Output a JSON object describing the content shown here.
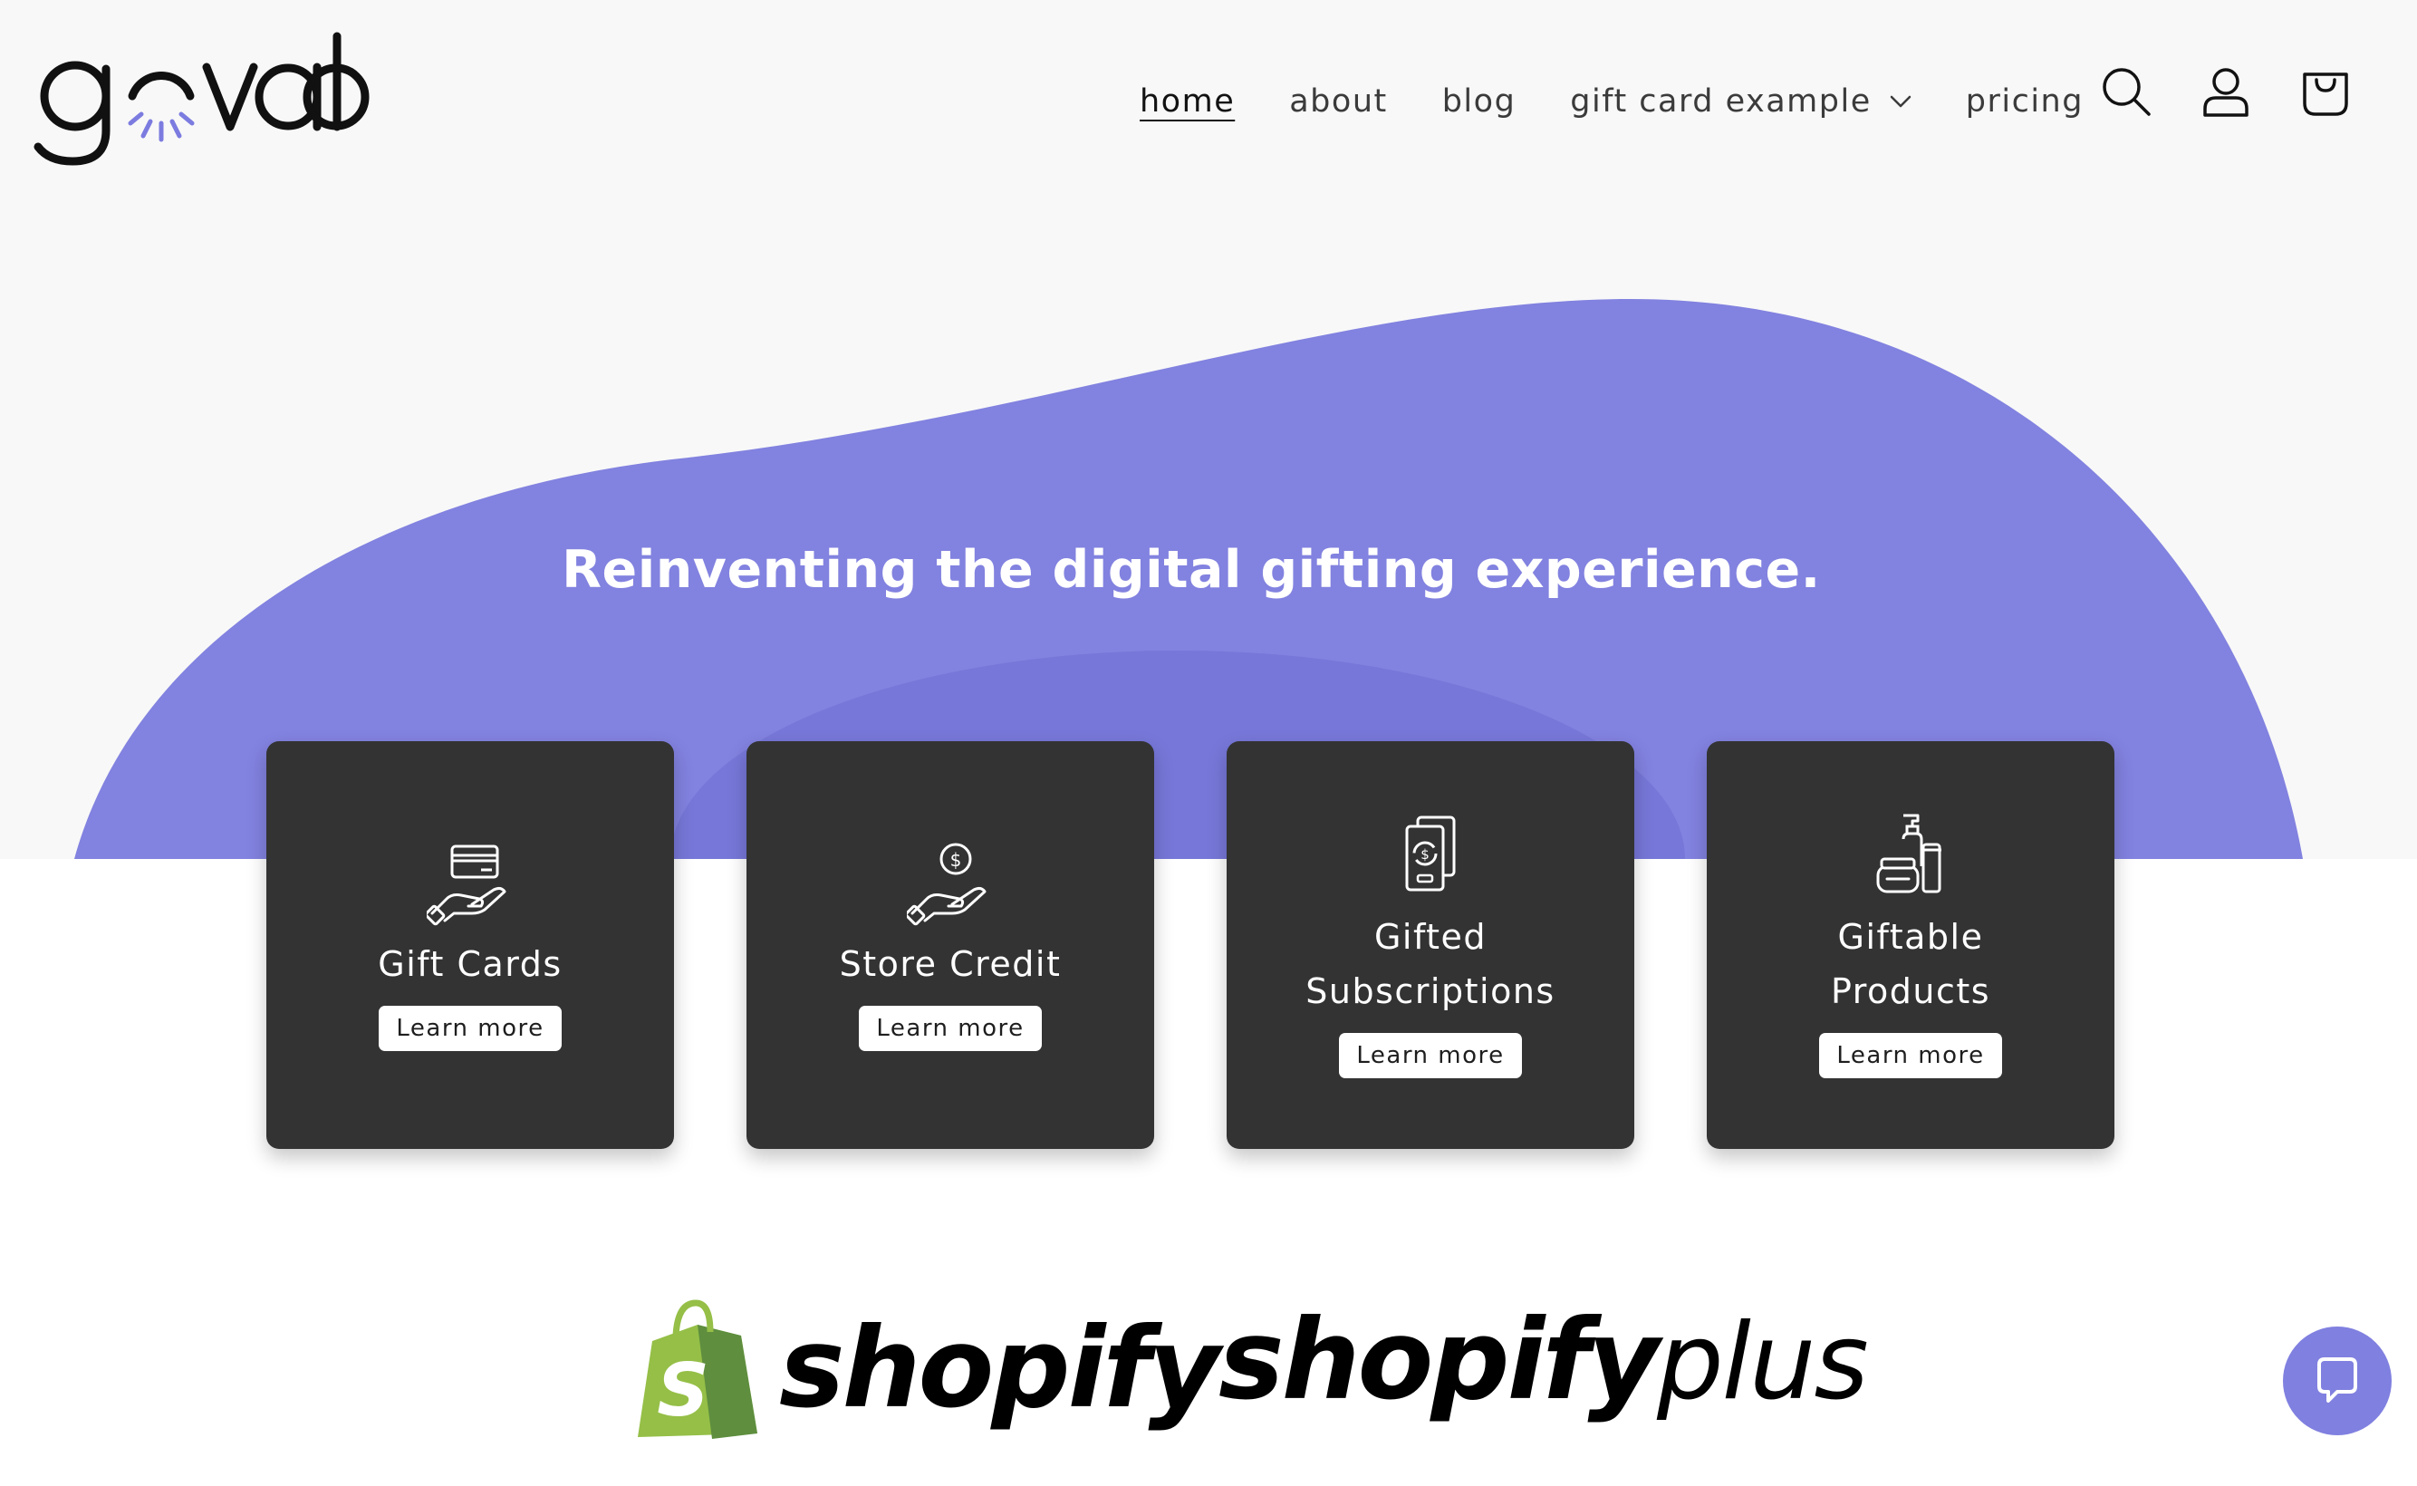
{
  "brand": {
    "logo_text": "govalo",
    "accent_color": "#8282e0"
  },
  "nav": {
    "items": [
      {
        "label": "home",
        "active": true
      },
      {
        "label": "about",
        "active": false
      },
      {
        "label": "blog",
        "active": false
      },
      {
        "label": "gift card example",
        "active": false,
        "has_dropdown": true
      },
      {
        "label": "pricing",
        "active": false
      }
    ]
  },
  "header_icons": [
    "search-icon",
    "account-icon",
    "cart-icon"
  ],
  "hero": {
    "title": "Reinventing the digital gifting experience."
  },
  "cards": [
    {
      "title": "Gift Cards",
      "button": "Learn more",
      "icon": "gift-card-hand-icon"
    },
    {
      "title": "Store Credit",
      "button": "Learn more",
      "icon": "coin-hand-icon"
    },
    {
      "title": "Gifted Subscriptions",
      "button": "Learn more",
      "icon": "subscription-card-icon"
    },
    {
      "title": "Giftable Products",
      "button": "Learn more",
      "icon": "products-bottles-icon"
    }
  ],
  "partners": {
    "shopify": "shopify",
    "shopify_plus_bold": "shopify",
    "shopify_plus_light": "plus"
  },
  "chat": {
    "icon": "chat-bubble-icon",
    "color": "#8080e0"
  }
}
